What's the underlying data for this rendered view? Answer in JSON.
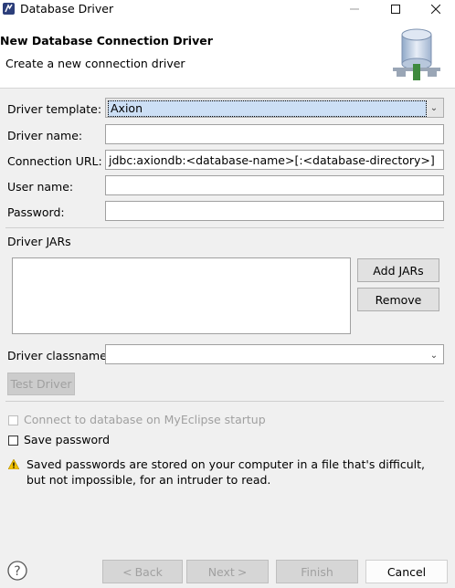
{
  "window": {
    "title": "Database Driver"
  },
  "header": {
    "title": "New Database Connection Driver",
    "description": "Create a new connection driver"
  },
  "form": {
    "driver_template": {
      "label": "Driver template:",
      "value": "Axion"
    },
    "driver_name": {
      "label": "Driver name:",
      "value": ""
    },
    "connection_url": {
      "label": "Connection URL:",
      "value": "jdbc:axiondb:<database-name>[:<database-directory>]"
    },
    "user_name": {
      "label": "User name:",
      "value": ""
    },
    "password": {
      "label": "Password:",
      "value": ""
    },
    "driver_jars": {
      "label": "Driver JARs",
      "add_label": "Add JARs",
      "remove_label": "Remove"
    },
    "driver_classname": {
      "label": "Driver classname:",
      "value": ""
    },
    "test_driver_label": "Test Driver",
    "connect_on_startup": {
      "label": "Connect to database on MyEclipse startup",
      "checked": false,
      "enabled": false
    },
    "save_password": {
      "label": "Save password",
      "checked": false
    },
    "warning": "Saved passwords are stored on your computer in a file that's difficult, but not impossible, for an intruder to read."
  },
  "footer": {
    "back_label": "Back",
    "next_label": "Next",
    "finish_label": "Finish",
    "cancel_label": "Cancel"
  },
  "icons": {
    "app": "eclipse-app-icon",
    "header": "database-connection-icon",
    "warning": "warning-icon",
    "help": "help-icon"
  }
}
